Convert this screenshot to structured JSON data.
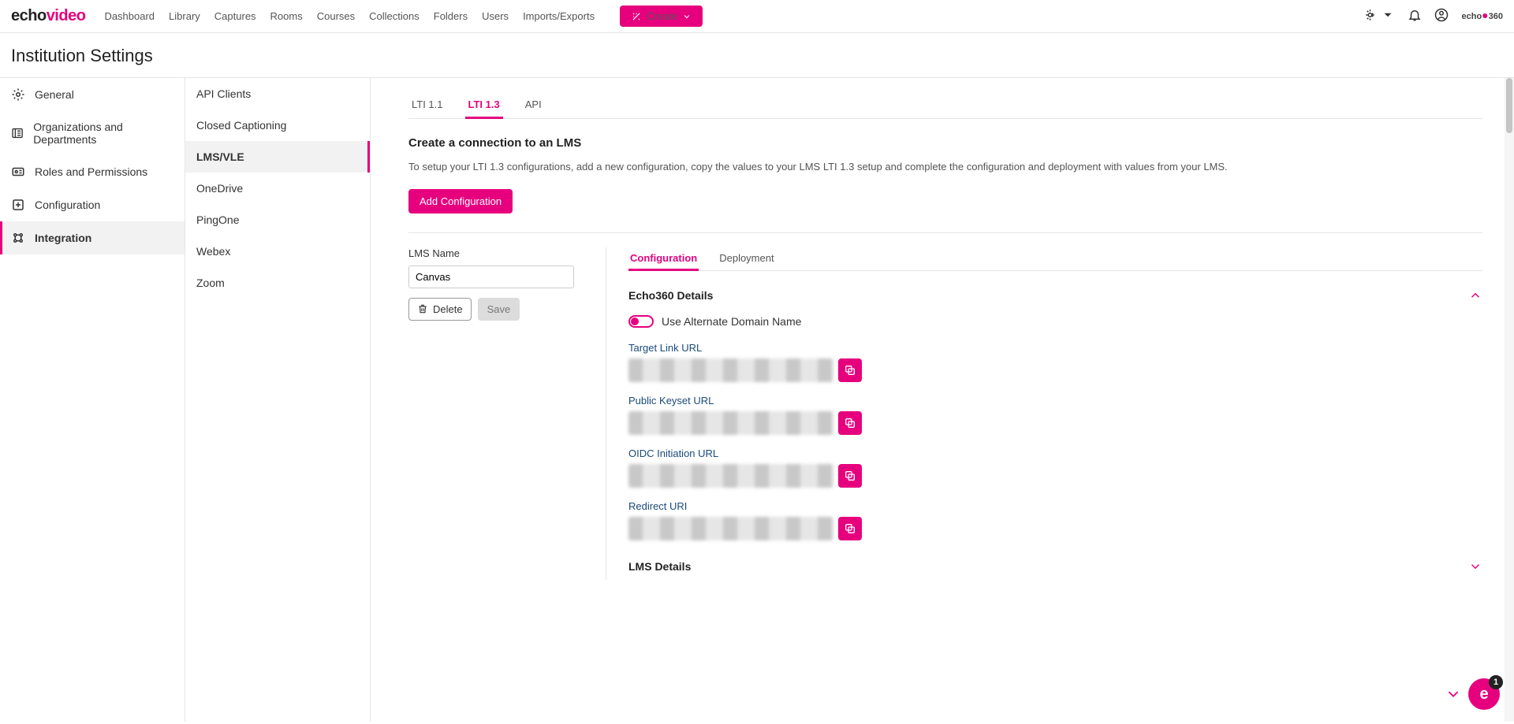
{
  "logo": {
    "part1": "echo",
    "part2": "video"
  },
  "nav": {
    "items": [
      "Dashboard",
      "Library",
      "Captures",
      "Rooms",
      "Courses",
      "Collections",
      "Folders",
      "Users",
      "Imports/Exports"
    ],
    "create": "Create"
  },
  "page_title": "Institution Settings",
  "sidebar1": {
    "items": [
      {
        "label": "General",
        "icon": "gear"
      },
      {
        "label": "Organizations and Departments",
        "icon": "org"
      },
      {
        "label": "Roles and Permissions",
        "icon": "id"
      },
      {
        "label": "Configuration",
        "icon": "plus-box"
      },
      {
        "label": "Integration",
        "icon": "integration",
        "active": true
      }
    ]
  },
  "sidebar2": {
    "items": [
      {
        "label": "API Clients"
      },
      {
        "label": "Closed Captioning"
      },
      {
        "label": "LMS/VLE",
        "active": true
      },
      {
        "label": "OneDrive"
      },
      {
        "label": "PingOne"
      },
      {
        "label": "Webex"
      },
      {
        "label": "Zoom"
      }
    ]
  },
  "tabs": {
    "items": [
      {
        "label": "LTI 1.1"
      },
      {
        "label": "LTI 1.3",
        "active": true
      },
      {
        "label": "API"
      }
    ]
  },
  "section": {
    "heading": "Create a connection to an LMS",
    "sub": "To setup your LTI 1.3 configurations, add a new configuration, copy the values to your LMS LTI 1.3 setup and complete the configuration and deployment with values from your LMS.",
    "add_btn": "Add Configuration"
  },
  "lms_form": {
    "name_label": "LMS Name",
    "name_value": "Canvas",
    "delete_label": "Delete",
    "save_label": "Save"
  },
  "subtabs": {
    "items": [
      {
        "label": "Configuration",
        "active": true
      },
      {
        "label": "Deployment"
      }
    ]
  },
  "details": {
    "echo_header": "Echo360 Details",
    "toggle_label": "Use Alternate Domain Name",
    "fields": [
      {
        "label": "Target Link URL"
      },
      {
        "label": "Public Keyset URL"
      },
      {
        "label": "OIDC Initiation URL"
      },
      {
        "label": "Redirect URI"
      }
    ],
    "lms_header": "LMS Details"
  },
  "fab": {
    "badge": "1"
  }
}
